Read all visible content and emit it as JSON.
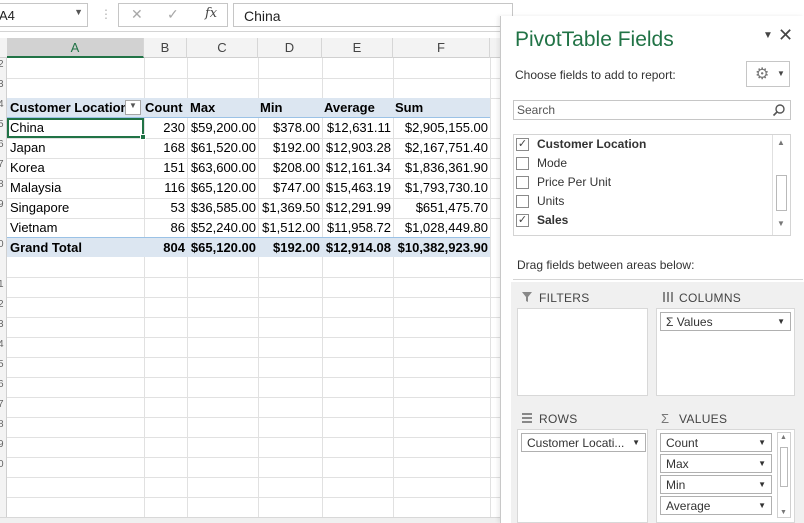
{
  "formula_bar": {
    "name_box": "A4",
    "dots": "⋮",
    "cancel_glyph": "✕",
    "enter_glyph": "✓",
    "fx_label": "fx",
    "formula": "China"
  },
  "columns": [
    "A",
    "B",
    "C",
    "D",
    "E",
    "F"
  ],
  "row_header_digits": [
    "2",
    "3",
    "4",
    "5",
    "6",
    "7",
    "8",
    "9",
    "0",
    "1",
    "2",
    "3",
    "4",
    "5",
    "6",
    "7",
    "8",
    "9",
    "0"
  ],
  "pivot": {
    "headers": [
      "Customer Location",
      "Count",
      "Max",
      "Min",
      "Average",
      "Sum"
    ],
    "rows": [
      [
        "China",
        "230",
        "$59,200.00",
        "$378.00",
        "$12,631.11",
        "$2,905,155.00"
      ],
      [
        "Japan",
        "168",
        "$61,520.00",
        "$192.00",
        "$12,903.28",
        "$2,167,751.40"
      ],
      [
        "Korea",
        "151",
        "$63,600.00",
        "$208.00",
        "$12,161.34",
        "$1,836,361.90"
      ],
      [
        "Malaysia",
        "116",
        "$65,120.00",
        "$747.00",
        "$15,463.19",
        "$1,793,730.10"
      ],
      [
        "Singapore",
        "53",
        "$36,585.00",
        "$1,369.50",
        "$12,291.99",
        "$651,475.70"
      ],
      [
        "Vietnam",
        "86",
        "$52,240.00",
        "$1,512.00",
        "$11,958.72",
        "$1,028,449.80"
      ]
    ],
    "total": [
      "Grand Total",
      "804",
      "$65,120.00",
      "$192.00",
      "$12,914.08",
      "$10,382,923.90"
    ]
  },
  "panel": {
    "title": "PivotTable Fields",
    "close_glyph": "✕",
    "choose_label": "Choose fields to add to report:",
    "search_placeholder": "Search",
    "fields": [
      {
        "label": "Customer Location",
        "checked": true
      },
      {
        "label": "Mode",
        "checked": false
      },
      {
        "label": "Price Per Unit",
        "checked": false
      },
      {
        "label": "Units",
        "checked": false
      },
      {
        "label": "Sales",
        "checked": true
      }
    ],
    "drag_label": "Drag fields between areas below:",
    "areas": {
      "filters": {
        "title": "FILTERS",
        "icon": "filter-icon"
      },
      "columns": {
        "title": "COLUMNS",
        "icon": "columns-icon",
        "items": [
          "Values"
        ]
      },
      "rows": {
        "title": "ROWS",
        "icon": "rows-icon",
        "items": [
          "Customer Locati..."
        ]
      },
      "values": {
        "title": "VALUES",
        "icon": "sigma-icon",
        "items": [
          "Count",
          "Max",
          "Min",
          "Average"
        ]
      }
    }
  },
  "colors": {
    "accent": "#217346",
    "pivot_header": "#dce6f1"
  }
}
